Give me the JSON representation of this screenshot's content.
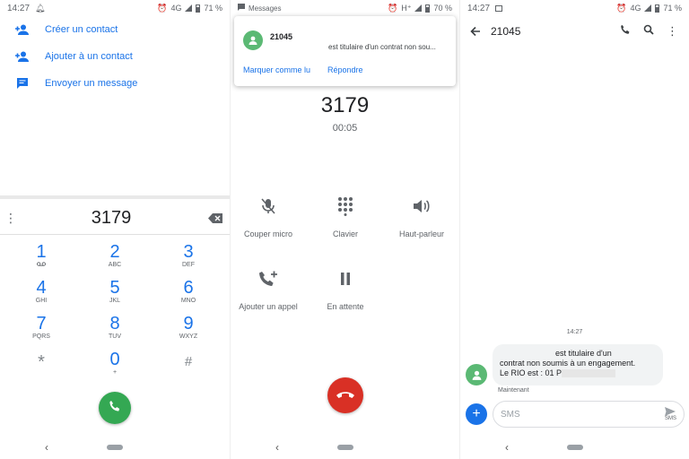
{
  "panel_dialer": {
    "status": {
      "time": "14:27",
      "network": "4G",
      "battery": "71 %"
    },
    "menu": [
      {
        "label": "Créer un contact",
        "icon": "person-add-icon"
      },
      {
        "label": "Ajouter à un contact",
        "icon": "person-add-icon"
      },
      {
        "label": "Envoyer un message",
        "icon": "message-icon"
      }
    ],
    "dialed_number": "3179",
    "keys": [
      {
        "digit": "1",
        "letters": ""
      },
      {
        "digit": "2",
        "letters": "ABC"
      },
      {
        "digit": "3",
        "letters": "DEF"
      },
      {
        "digit": "4",
        "letters": "GHI"
      },
      {
        "digit": "5",
        "letters": "JKL"
      },
      {
        "digit": "6",
        "letters": "MNO"
      },
      {
        "digit": "7",
        "letters": "PQRS"
      },
      {
        "digit": "8",
        "letters": "TUV"
      },
      {
        "digit": "9",
        "letters": "WXYZ"
      },
      {
        "digit": "*",
        "letters": ""
      },
      {
        "digit": "0",
        "letters": "+"
      },
      {
        "digit": "#",
        "letters": ""
      }
    ]
  },
  "panel_call": {
    "status": {
      "app": "Messages",
      "network": "H⁺",
      "battery": "70 %"
    },
    "notification": {
      "sender": "21045",
      "text": "est titulaire d'un contrat non sou...",
      "action_mark_read": "Marquer comme lu",
      "action_reply": "Répondre"
    },
    "number": "3179",
    "timer": "00:05",
    "controls": [
      {
        "label": "Couper micro",
        "icon": "mic-off-icon"
      },
      {
        "label": "Clavier",
        "icon": "dialpad-icon"
      },
      {
        "label": "Haut-parleur",
        "icon": "speaker-icon"
      },
      {
        "label": "Ajouter un appel",
        "icon": "add-call-icon"
      },
      {
        "label": "En attente",
        "icon": "pause-icon"
      }
    ]
  },
  "panel_messages": {
    "status": {
      "time": "14:27",
      "network": "4G",
      "battery": "71 %"
    },
    "title": "21045",
    "message_time": "14:27",
    "message_line1": "est titulaire d'un",
    "message_line2": "contrat non soumis à un engagement.",
    "message_line3": "Le RIO est : 01 P",
    "message_status": "Maintenant",
    "compose_placeholder": "SMS",
    "send_label": "SMS"
  },
  "colors": {
    "accent": "#1a73e8",
    "call_green": "#34a853",
    "end_red": "#d93025",
    "avatar_green": "#5bb974"
  }
}
